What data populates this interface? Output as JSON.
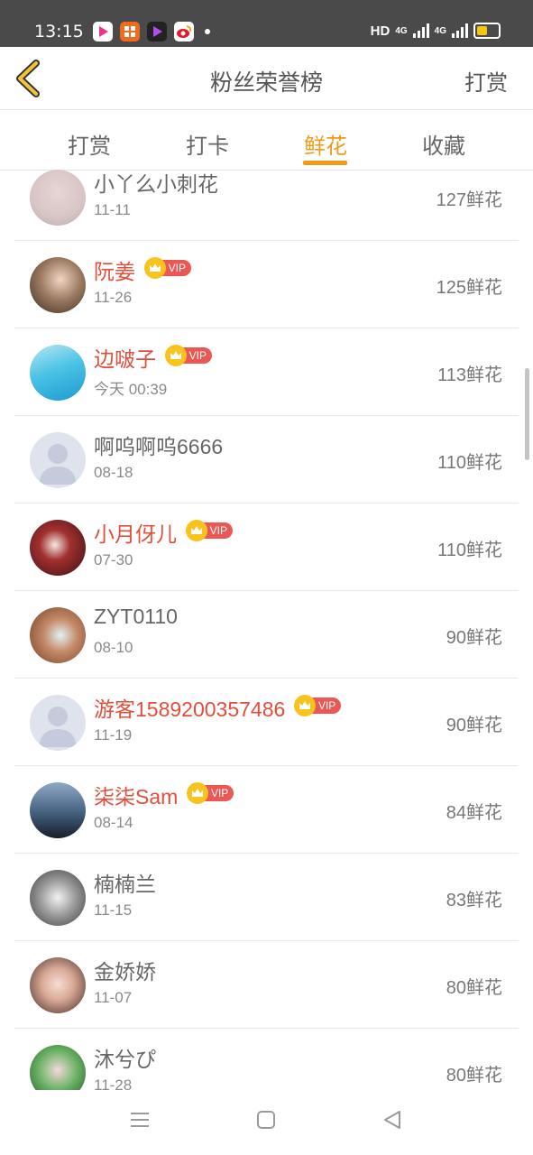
{
  "status_bar": {
    "time": "13:15",
    "network": "HD",
    "signal1": "4G",
    "signal2": "4G"
  },
  "header": {
    "title": "粉丝荣誉榜",
    "action": "打赏"
  },
  "tabs": [
    {
      "label": "打赏",
      "active": false
    },
    {
      "label": "打卡",
      "active": false
    },
    {
      "label": "鲜花",
      "active": true
    },
    {
      "label": "收藏",
      "active": false
    }
  ],
  "vip_label": "VIP",
  "rows": [
    {
      "name": "小丫么小刺花",
      "date": "11-11",
      "count": "127鲜花",
      "vip": false
    },
    {
      "name": "阮姜",
      "date": "11-26",
      "count": "125鲜花",
      "vip": true
    },
    {
      "name": "边啵子",
      "date": "今天 00:39",
      "count": "113鲜花",
      "vip": true
    },
    {
      "name": "啊呜啊呜6666",
      "date": "08-18",
      "count": "110鲜花",
      "vip": false
    },
    {
      "name": "小月伢儿",
      "date": "07-30",
      "count": "110鲜花",
      "vip": true
    },
    {
      "name": "ZYT0110",
      "date": "08-10",
      "count": "90鲜花",
      "vip": false
    },
    {
      "name": "游客1589200357486",
      "date": "11-19",
      "count": "90鲜花",
      "vip": true
    },
    {
      "name": "柒柒Sam",
      "date": "08-14",
      "count": "84鲜花",
      "vip": true
    },
    {
      "name": "楠楠兰",
      "date": "11-15",
      "count": "83鲜花",
      "vip": false
    },
    {
      "name": "金娇娇",
      "date": "11-07",
      "count": "80鲜花",
      "vip": false
    },
    {
      "name": "沐兮ぴ",
      "date": "11-28",
      "count": "80鲜花",
      "vip": false
    }
  ],
  "colors": {
    "accent": "#f09a17",
    "vip_name": "#e14f3c",
    "vip_badge": "#eb5753"
  }
}
